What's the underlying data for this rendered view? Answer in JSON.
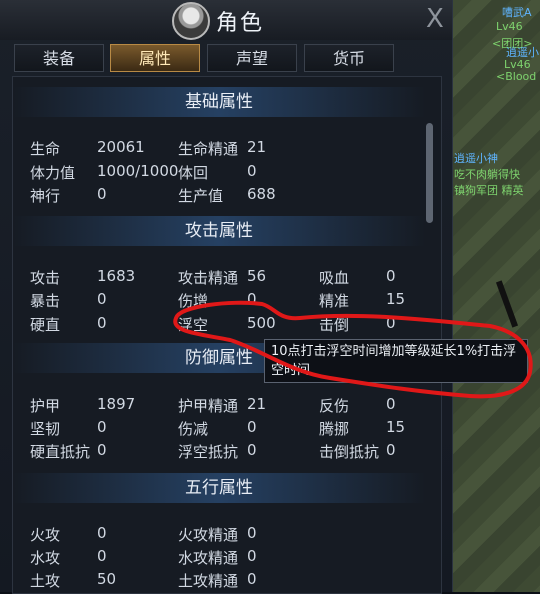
{
  "window": {
    "title": "角色",
    "close": "X"
  },
  "tabs": [
    "装备",
    "属性",
    "声望",
    "货币"
  ],
  "active_tab": "属性",
  "sections": {
    "basic": {
      "title": "基础属性",
      "rows": [
        [
          "生命",
          "20061",
          "生命精通",
          "21"
        ],
        [
          "体力值",
          "1000/1000",
          "体回",
          "0"
        ],
        [
          "神行",
          "0",
          "生产值",
          "688"
        ]
      ]
    },
    "attack": {
      "title": "攻击属性",
      "rows": [
        [
          "攻击",
          "1683",
          "攻击精通",
          "56",
          "吸血",
          "0"
        ],
        [
          "暴击",
          "0",
          "伤增",
          "0",
          "精准",
          "15"
        ],
        [
          "硬直",
          "0",
          "浮空",
          "500",
          "击倒",
          "0"
        ]
      ]
    },
    "defense": {
      "title": "防御属性",
      "rows": [
        [
          "护甲",
          "1897",
          "护甲精通",
          "21",
          "反伤",
          "0"
        ],
        [
          "坚韧",
          "0",
          "伤减",
          "0",
          "腾挪",
          "15"
        ],
        [
          "硬直抵抗",
          "0",
          "浮空抵抗",
          "0",
          "击倒抵抗",
          "0"
        ]
      ]
    },
    "elements": {
      "title": "五行属性",
      "rows": [
        [
          "火攻",
          "0",
          "火攻精通",
          "0"
        ],
        [
          "水攻",
          "0",
          "水攻精通",
          "0"
        ],
        [
          "土攻",
          "50",
          "土攻精通",
          "0"
        ]
      ]
    }
  },
  "tooltip": {
    "line1": "10点打击浮空时间增加等级延长1%打击浮",
    "line2": "空时间"
  },
  "world_labels": [
    {
      "text": "嘈武A",
      "class": "blue"
    },
    {
      "text": "Lv46",
      "class": "green"
    },
    {
      "text": "<团团>",
      "class": "green"
    },
    {
      "text": "逍遥小",
      "class": "blue"
    },
    {
      "text": "Lv46",
      "class": "green"
    },
    {
      "text": "<Blood",
      "class": "green"
    },
    {
      "text": "逍遥小神",
      "class": "blue"
    },
    {
      "text": "吃不肉躺得快",
      "class": "green"
    },
    {
      "text": "镇狗军团 精英",
      "class": "green"
    }
  ]
}
